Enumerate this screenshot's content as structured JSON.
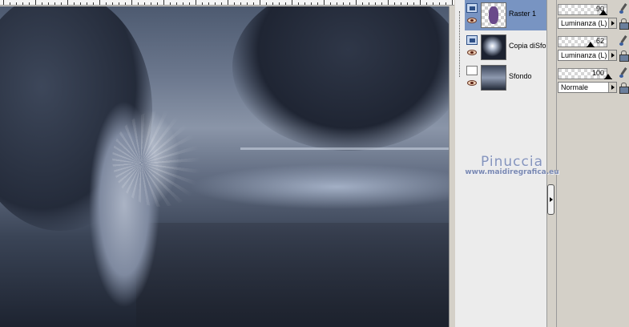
{
  "layers": [
    {
      "name": "Raster 1",
      "thumb": "purple figure on transparency",
      "selected": true,
      "type": "raster-layer-icon"
    },
    {
      "name": "Copia diSfo",
      "thumb": "light burst on dark",
      "selected": false,
      "type": "raster-layer-icon"
    },
    {
      "name": "Sfondo",
      "thumb": "landscape",
      "selected": false,
      "type": "background-layer-icon"
    }
  ],
  "properties": [
    {
      "opacity": "90",
      "blend_mode": "Luminanza (L)",
      "marker": 0.9
    },
    {
      "opacity": "62",
      "blend_mode": "Luminanza (L)",
      "marker": 0.62
    },
    {
      "opacity": "100",
      "blend_mode": "Normale",
      "marker": 1.0
    }
  ],
  "watermark": {
    "name": "Pinuccia",
    "url": "www.maidiregrafica.eu"
  },
  "colors": {
    "selected_layer": "#7894c2",
    "panel_bg": "#d4d0c8",
    "watermark": "#8594bc"
  }
}
